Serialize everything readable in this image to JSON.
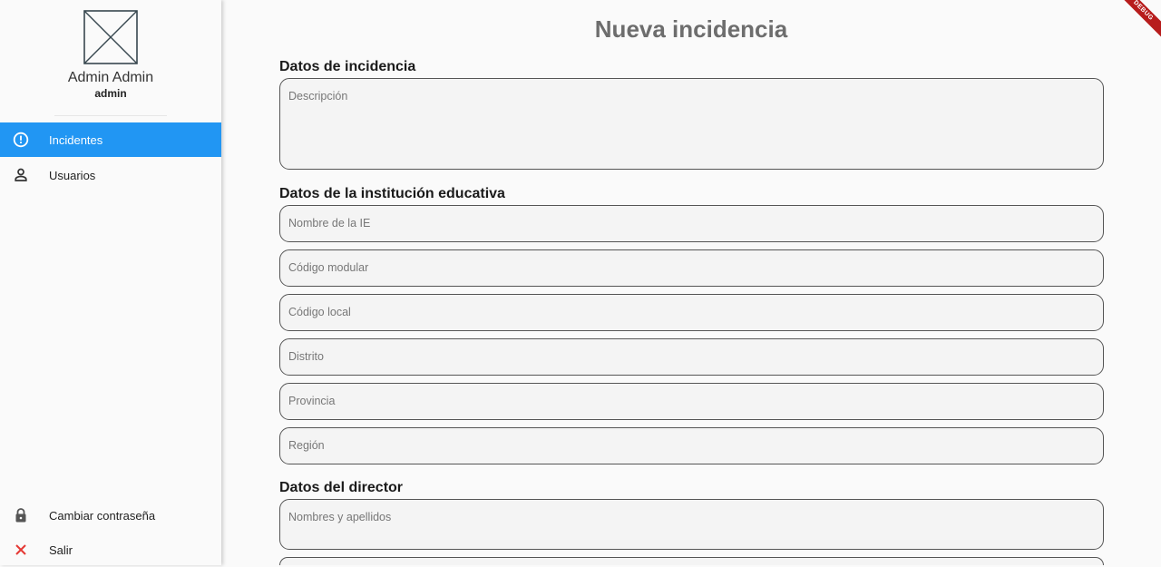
{
  "sidebar": {
    "user_name": "Admin Admin",
    "user_handle": "admin",
    "nav": [
      {
        "label": "Incidentes",
        "icon": "alert-circle-icon",
        "active": true
      },
      {
        "label": "Usuarios",
        "icon": "person-icon",
        "active": false
      }
    ],
    "bottom": [
      {
        "label": "Cambiar contraseña",
        "icon": "lock-icon"
      },
      {
        "label": "Salir",
        "icon": "close-icon"
      }
    ]
  },
  "debug_label": "DEBUG",
  "main": {
    "title": "Nueva incidencia",
    "sections": {
      "incidencia": {
        "title": "Datos de incidencia",
        "descripcion_placeholder": "Descripción"
      },
      "institucion": {
        "title": "Datos de la institución educativa",
        "fields": [
          "Nombre de la IE",
          "Código modular",
          "Código local",
          "Distrito",
          "Provincia",
          "Región"
        ]
      },
      "director": {
        "title": "Datos del director",
        "fields": [
          "Nombres y apellidos"
        ]
      }
    }
  },
  "colors": {
    "accent": "#2196f3",
    "debug": "#b71c1c",
    "close": "#e53935"
  }
}
